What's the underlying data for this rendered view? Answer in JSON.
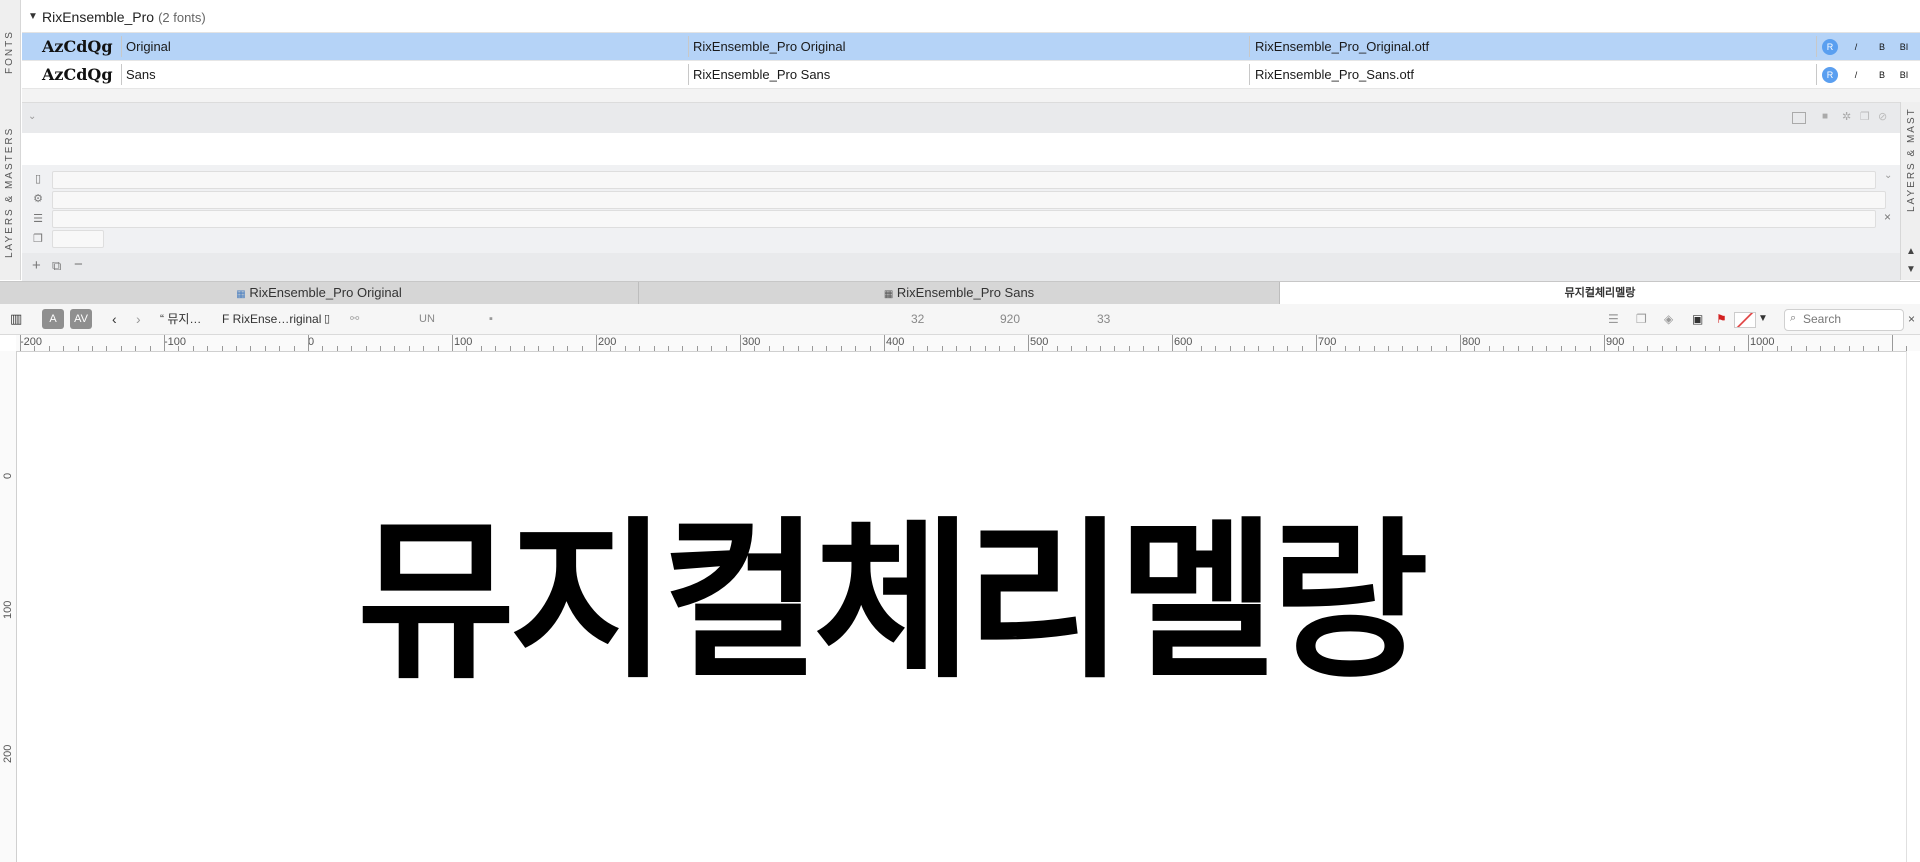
{
  "side_labels": {
    "fonts": "FONTS",
    "layers": "LAYERS & MASTERS",
    "right": "LAYERS & MAST"
  },
  "family": {
    "name": "RixEnsemble_Pro",
    "count": "(2 fonts)"
  },
  "fonts": [
    {
      "sample": "AzCdQg",
      "style": "Original",
      "full_name": "RixEnsemble_Pro Original",
      "file": "RixEnsemble_Pro_Original.otf",
      "selected": true
    },
    {
      "sample": "AzCdQg",
      "style": "Sans",
      "full_name": "RixEnsemble_Pro Sans",
      "file": "RixEnsemble_Pro_Sans.otf",
      "selected": false
    }
  ],
  "style_buttons": [
    "R",
    "/",
    "B",
    "BI"
  ],
  "tabs": [
    {
      "label": "RixEnsemble_Pro Original"
    },
    {
      "label": "RixEnsemble_Pro Sans"
    },
    {
      "label": "뮤지컬체리멜랑"
    }
  ],
  "toolbar": {
    "glyph_preview": "“ 뮤지…",
    "font_short": "F RixEnse…riginal",
    "unicode": "UN",
    "value1": "32",
    "value2": "920",
    "value3": "33",
    "search_placeholder": "Search"
  },
  "ruler": {
    "labels": [
      "-200",
      "-100",
      "0",
      "100",
      "200",
      "300",
      "400",
      "500",
      "600",
      "700",
      "800",
      "900",
      "1000"
    ],
    "vertical_labels": [
      "0",
      "100",
      "200"
    ]
  },
  "canvas_text": "뮤지컬체리멜랑",
  "colors": {
    "selection": "#b5d3f7",
    "accent": "#5a9ff0",
    "flag": "#d32020"
  }
}
